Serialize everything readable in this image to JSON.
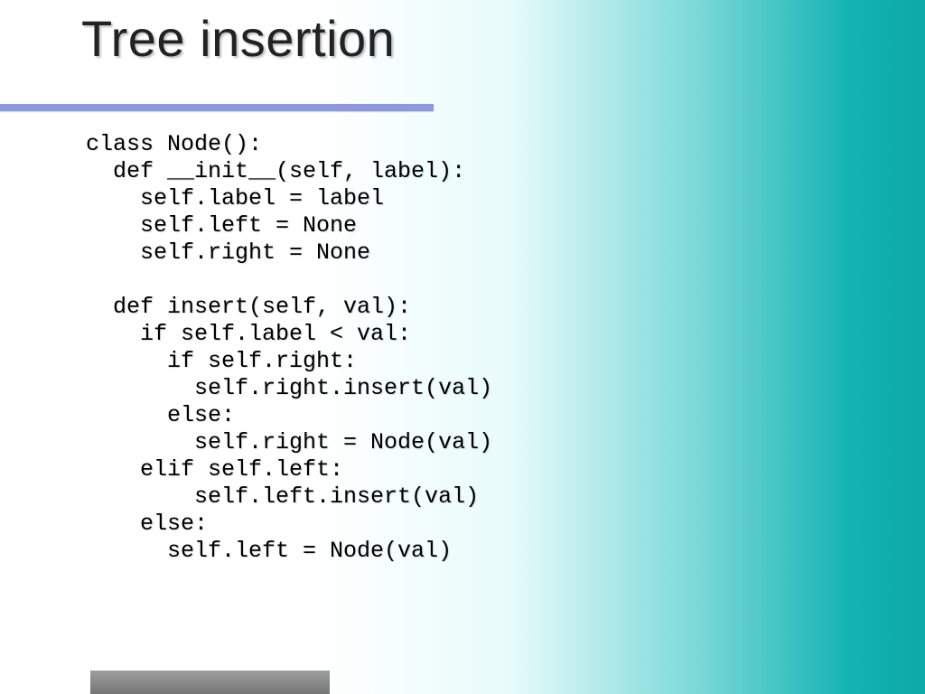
{
  "slide": {
    "title": "Tree insertion",
    "code": "class Node():\n  def __init__(self, label):\n    self.label = label\n    self.left = None\n    self.right = None\n\n  def insert(self, val):\n    if self.label < val:\n      if self.right:\n        self.right.insert(val)\n      else:\n        self.right = Node(val)\n    elif self.left:\n        self.left.insert(val)\n    else:\n      self.left = Node(val)"
  }
}
